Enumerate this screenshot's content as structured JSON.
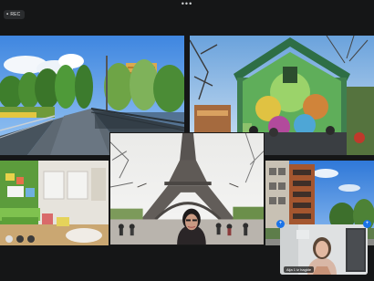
{
  "meeting": {
    "recording_label": "REC",
    "more_menu_glyph": "•••"
  },
  "tiles": [
    {
      "name": "bridge-park-scene",
      "description_icon": "image-icon"
    },
    {
      "name": "mural-building-scene",
      "description_icon": "image-icon"
    },
    {
      "name": "classroom-scene",
      "description_icon": "image-icon"
    },
    {
      "name": "eiffel-tower-presenter",
      "description_icon": "image-icon"
    },
    {
      "name": "apartment-building-scene",
      "description_icon": "image-icon"
    }
  ],
  "self_view": {
    "name_label": "Aija 1 iz hagide"
  },
  "colors": {
    "background": "#151617",
    "accent": "#1a73e8"
  }
}
